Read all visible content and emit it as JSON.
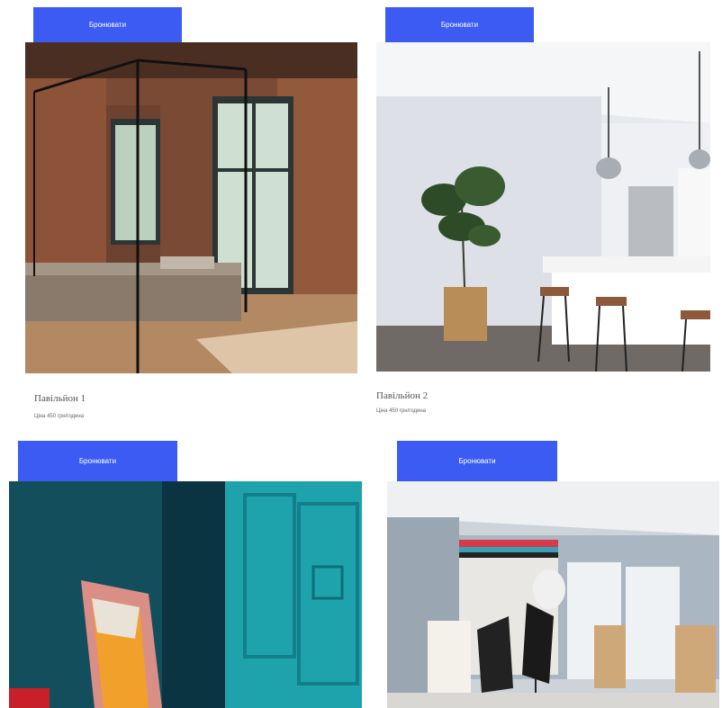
{
  "cards": [
    {
      "button": "Бронювати",
      "title": "Павільйон 1",
      "price": "Ціна 450 грн/година",
      "photo_icon": "loft-bedroom-photo"
    },
    {
      "button": "Бронювати",
      "title": "Павільйон 2",
      "price": "Ціна 450 грн/година",
      "photo_icon": "white-kitchen-photo"
    },
    {
      "button": "Бронювати",
      "photo_icon": "teal-room-photo"
    },
    {
      "button": "Бронювати",
      "photo_icon": "photo-studio-photo"
    }
  ],
  "colors": {
    "accent": "#3c5bf2"
  }
}
